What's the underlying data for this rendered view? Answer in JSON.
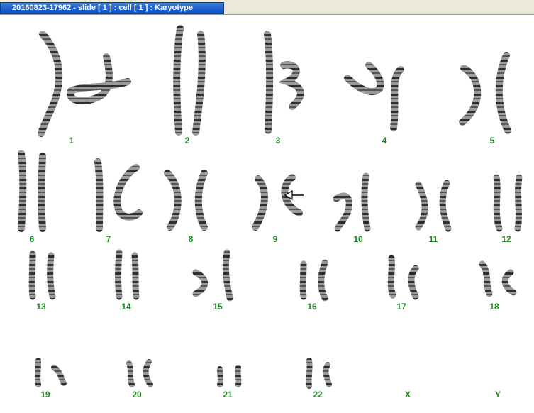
{
  "window": {
    "title": "20160823-17962 - slide [ 1 ] : cell [ 1 ] : Karyotype"
  },
  "karyotype": {
    "labels": [
      "1",
      "2",
      "3",
      "4",
      "5",
      "6",
      "7",
      "8",
      "9",
      "10",
      "11",
      "12",
      "13",
      "14",
      "15",
      "16",
      "17",
      "18",
      "19",
      "20",
      "21",
      "22",
      "X",
      "Y"
    ],
    "annotation": "arrow-icon"
  },
  "colors": {
    "label": "#1e8a1e",
    "chromosome": "#3c3c3c",
    "title_bar": "#0a4fc4"
  }
}
